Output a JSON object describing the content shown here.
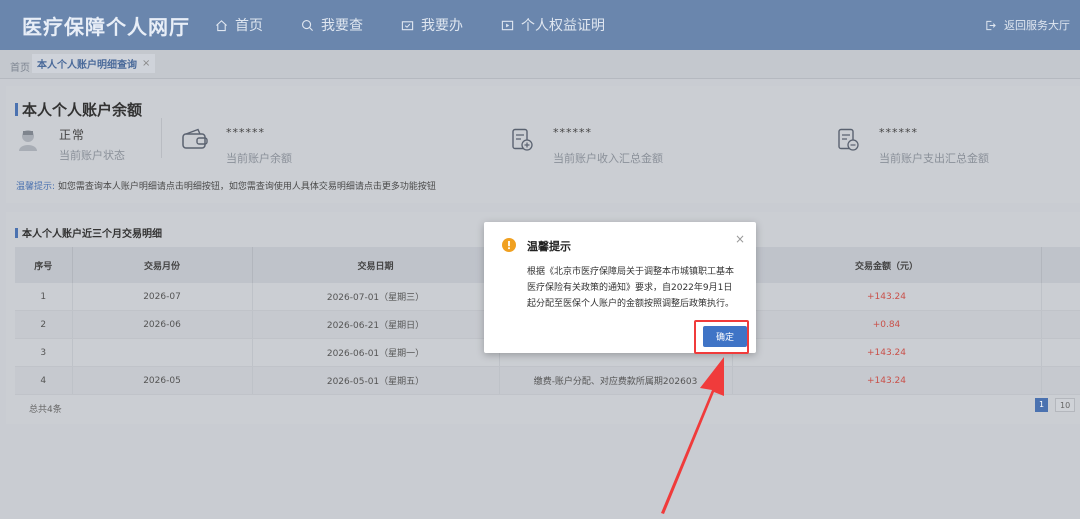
{
  "app": {
    "title": "医疗保障个人网厅"
  },
  "nav": [
    {
      "label": "首页",
      "icon": "home-icon"
    },
    {
      "label": "我要查",
      "icon": "search-icon"
    },
    {
      "label": "我要办",
      "icon": "folder-icon"
    },
    {
      "label": "个人权益证明",
      "icon": "certificate-icon"
    }
  ],
  "header": {
    "back_label": "返回服务大厅"
  },
  "tabs": {
    "home": "首页",
    "active": "本人个人账户明细查询",
    "close": "×"
  },
  "balance": {
    "title": "本人个人账户余额",
    "status_value": "正常",
    "status_label": "当前账户状态",
    "stats": [
      {
        "value": "******",
        "label": "当前账户余额",
        "icon": "wallet-icon"
      },
      {
        "value": "******",
        "label": "当前账户收入汇总金额",
        "icon": "document-plus-icon"
      },
      {
        "value": "******",
        "label": "当前账户支出汇总金额",
        "icon": "document-minus-icon"
      }
    ],
    "tip_prefix": "温馨提示:",
    "tip_text": "如您需查询本人账户明细请点击明细按钮，如您需查询使用人具体交易明细请点击更多功能按钮"
  },
  "transactions": {
    "title": "本人个人账户近三个月交易明细",
    "columns": [
      "序号",
      "交易月份",
      "交易日期",
      "",
      "交易金额（元）",
      ""
    ],
    "rows": [
      [
        "1",
        "2026-07",
        "2026-07-01（星期三）",
        "",
        "+143.24",
        ""
      ],
      [
        "2",
        "2026-06",
        "2026-06-21（星期日）",
        "",
        "+0.84",
        ""
      ],
      [
        "3",
        "",
        "2026-06-01（星期一）",
        "",
        "+143.24",
        ""
      ],
      [
        "4",
        "2026-05",
        "2026-05-01（星期五）",
        "缴费-账户分配、对应费款所属期202603",
        "+143.24",
        ""
      ]
    ],
    "total": "总共4条",
    "page_current": "1",
    "page_size": "10"
  },
  "modal": {
    "title": "温馨提示",
    "body": "根据《北京市医疗保障局关于调整本市城镇职工基本医疗保险有关政策的通知》要求，自2022年9月1日起分配至医保个人账户的金额按照调整后政策执行。",
    "confirm": "确定",
    "close": "×"
  },
  "colors": {
    "header": "#6a86ad",
    "accent": "#4b72b0",
    "button": "#3f74c6",
    "highlight": "#f03b3b",
    "amount": "#c9514a"
  }
}
